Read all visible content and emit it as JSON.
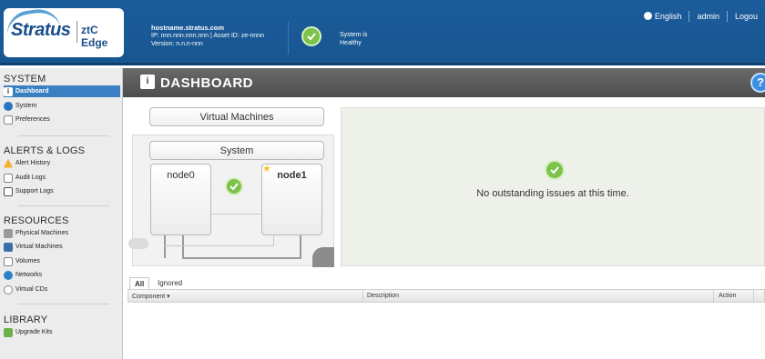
{
  "header": {
    "logo_text": "Stratus",
    "logo_sub": "ztC Edge",
    "hostname": "hostname.stratus.com",
    "ip_line": "IP: nnn.nnn.nnn.nnn | Asset ID: ze-nnnn",
    "version_line": "Version: n.n.n-nnn",
    "system_status": "System is Healthy",
    "language": "English",
    "user": "admin",
    "logout": "Logou"
  },
  "sidebar": {
    "sections": [
      {
        "title": "SYSTEM",
        "items": [
          "Dashboard",
          "System",
          "Preferences"
        ]
      },
      {
        "title": "ALERTS & LOGS",
        "items": [
          "Alert History",
          "Audit Logs",
          "Support Logs"
        ]
      },
      {
        "title": "RESOURCES",
        "items": [
          "Physical Machines",
          "Virtual Machines",
          "Volumes",
          "Networks",
          "Virtual CDs"
        ]
      },
      {
        "title": "LIBRARY",
        "items": [
          "Upgrade Kits"
        ]
      }
    ],
    "active_item": "Dashboard"
  },
  "page": {
    "title": "DASHBOARD",
    "help": "?"
  },
  "diagram": {
    "vm_label": "Virtual Machines",
    "system_label": "System",
    "node0": "node0",
    "node1": "node1"
  },
  "issues": {
    "message": "No outstanding issues at this time."
  },
  "tabs": [
    "All",
    "Ignored"
  ],
  "table": {
    "columns": [
      "Component",
      "Description",
      "Action"
    ]
  },
  "colors": {
    "header_blue": "#1c5c9c",
    "active_item": "#3a7fc1",
    "healthy_green": "#7dc24b",
    "pagebar_gray": "#5a5a5a"
  }
}
